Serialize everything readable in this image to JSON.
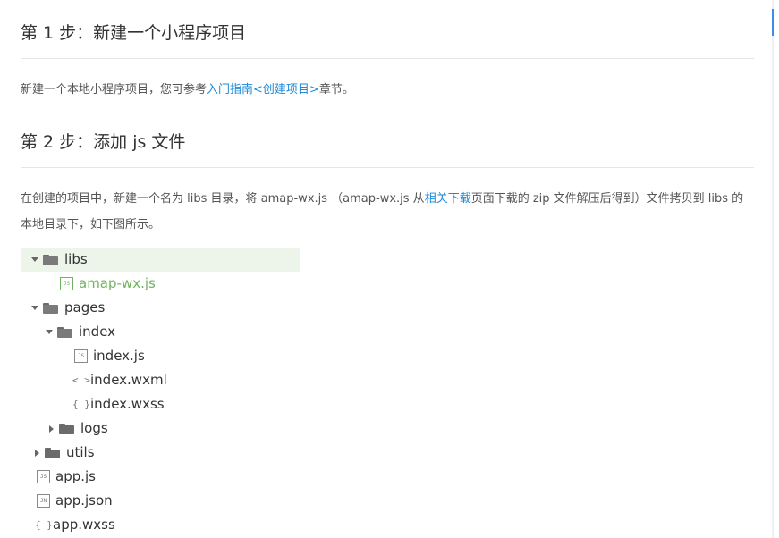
{
  "step1": {
    "title": "第 1 步：新建一个小程序项目",
    "text_before": "新建一个本地小程序项目，您可参考",
    "link": "入门指南<创建项目>",
    "text_after": "章节。"
  },
  "step2": {
    "title": "第 2 步：添加 js 文件",
    "text_before": "在创建的项目中，新建一个名为 libs 目录，将 amap-wx.js （amap-wx.js  从",
    "link": "相关下载",
    "text_after": "页面下载的 zip 文件解压后得到）文件拷贝到 libs 的本地目录下，如下图所示。"
  },
  "tree": {
    "items": [
      {
        "label": "libs",
        "kind": "folder-open",
        "icon": "folder-open-icon"
      },
      {
        "label": "amap-wx.js",
        "kind": "js-file",
        "badge": "JS",
        "icon": "js-file-icon"
      },
      {
        "label": "pages",
        "kind": "folder-open",
        "icon": "folder-open-icon"
      },
      {
        "label": "index",
        "kind": "folder-open",
        "icon": "folder-open-icon"
      },
      {
        "label": "index.js",
        "kind": "js-file",
        "badge": "JS",
        "icon": "js-file-icon"
      },
      {
        "label": "index.wxml",
        "kind": "markup-file",
        "symbol": "< >",
        "icon": "code-brackets-icon"
      },
      {
        "label": "index.wxss",
        "kind": "style-file",
        "symbol": "{ }",
        "icon": "curly-braces-icon"
      },
      {
        "label": "logs",
        "kind": "folder-closed",
        "icon": "folder-icon"
      },
      {
        "label": "utils",
        "kind": "folder-closed",
        "icon": "folder-icon"
      },
      {
        "label": "app.js",
        "kind": "js-file",
        "badge": "JS",
        "icon": "js-file-icon"
      },
      {
        "label": "app.json",
        "kind": "json-file",
        "badge": "JN",
        "icon": "json-file-icon"
      },
      {
        "label": "app.wxss",
        "kind": "style-file",
        "symbol": "{ }",
        "icon": "curly-braces-icon"
      }
    ]
  },
  "colors": {
    "link": "#1e8ad6",
    "highlight_bg": "#edf5ea",
    "highlight_text": "#6fb45e",
    "scroll_accent": "#3a8ee6"
  }
}
